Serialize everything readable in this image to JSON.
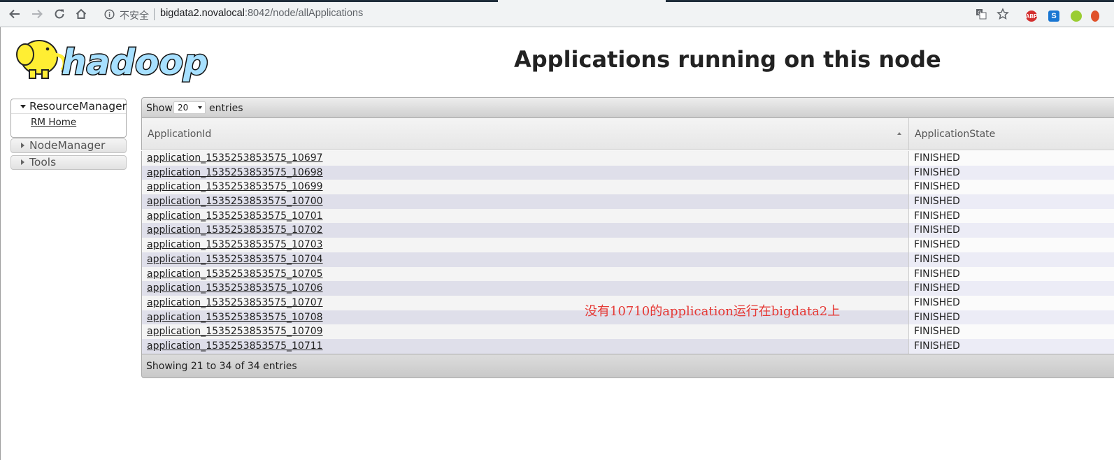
{
  "browser": {
    "url_host": "bigdata2.novalocal",
    "url_rest": ":8042/node/allApplications",
    "security_label": "不安全",
    "extensions": [
      "ABP",
      "S",
      "",
      ""
    ]
  },
  "header": {
    "logo_text": "hadoop",
    "title": "Applications running on this node"
  },
  "sidebar": {
    "resource_manager": "ResourceManager",
    "rm_home": "RM Home",
    "node_manager": "NodeManager",
    "tools": "Tools"
  },
  "table": {
    "show_label": "Show",
    "page_size": "20",
    "entries_label": "entries",
    "columns": [
      "ApplicationId",
      "ApplicationState"
    ],
    "rows": [
      {
        "id": "application_1535253853575_10697",
        "state": "FINISHED"
      },
      {
        "id": "application_1535253853575_10698",
        "state": "FINISHED"
      },
      {
        "id": "application_1535253853575_10699",
        "state": "FINISHED"
      },
      {
        "id": "application_1535253853575_10700",
        "state": "FINISHED"
      },
      {
        "id": "application_1535253853575_10701",
        "state": "FINISHED"
      },
      {
        "id": "application_1535253853575_10702",
        "state": "FINISHED"
      },
      {
        "id": "application_1535253853575_10703",
        "state": "FINISHED"
      },
      {
        "id": "application_1535253853575_10704",
        "state": "FINISHED"
      },
      {
        "id": "application_1535253853575_10705",
        "state": "FINISHED"
      },
      {
        "id": "application_1535253853575_10706",
        "state": "FINISHED"
      },
      {
        "id": "application_1535253853575_10707",
        "state": "FINISHED"
      },
      {
        "id": "application_1535253853575_10708",
        "state": "FINISHED"
      },
      {
        "id": "application_1535253853575_10709",
        "state": "FINISHED"
      },
      {
        "id": "application_1535253853575_10711",
        "state": "FINISHED"
      }
    ],
    "footer": "Showing 21 to 34 of 34 entries"
  },
  "annotation": "没有10710的application运行在bigdata2上",
  "colors": {
    "annotation": "#e53935",
    "row_even": "#dfdfea",
    "row_odd": "#f4f4f4",
    "logo_fill": "#a7e0ff",
    "elephant": "#ffee33"
  }
}
